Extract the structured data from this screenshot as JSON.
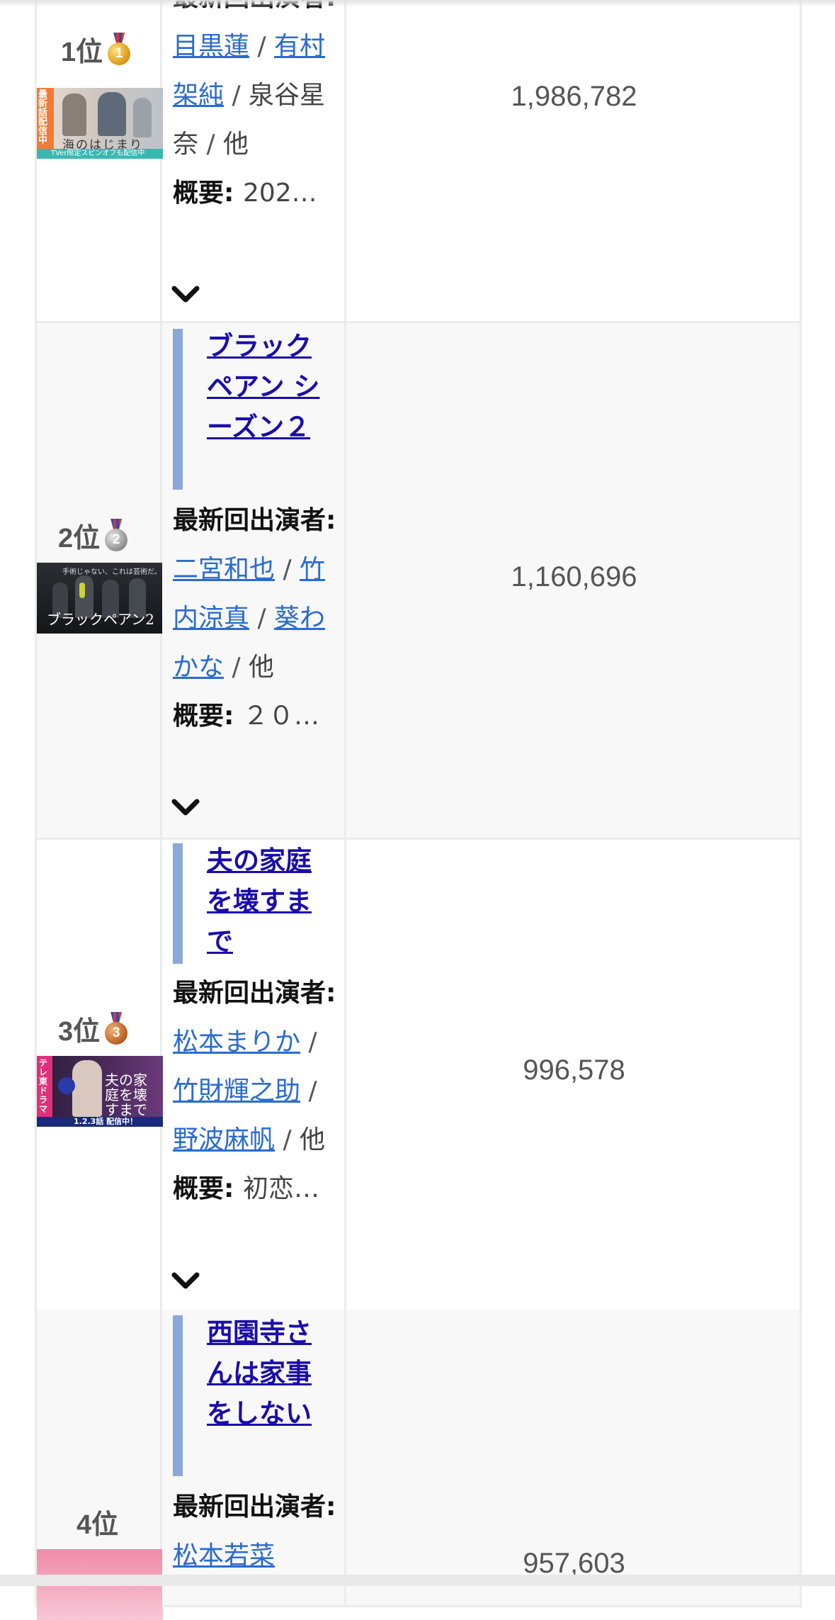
{
  "rows": [
    {
      "rank": "1位",
      "medal_number": "1",
      "medal_color": "#e0a020",
      "title": "",
      "cast_label": "最新回出演者",
      "cast": [
        "目黒蓮",
        "有村架純",
        "泉谷星奈",
        "他"
      ],
      "summary_label": "概要",
      "summary": "202…",
      "views": "1,986,782",
      "thumb_caption": "海のはじまり",
      "thumb_badge": "最新話配信中",
      "thumb_footer": "TVer限定スピンオフも配信中"
    },
    {
      "rank": "2位",
      "medal_number": "2",
      "medal_color": "#9a9a9a",
      "title": "ブラックペアン シーズン２",
      "cast_label": "最新回出演者",
      "cast": [
        "二宮和也",
        "竹内涼真",
        "葵わかな",
        "他"
      ],
      "summary_label": "概要",
      "summary": "２０…",
      "views": "1,160,696",
      "thumb_caption": "ブラックペアン2",
      "thumb_tagline": "手術じゃない、これは芸術だ。"
    },
    {
      "rank": "3位",
      "medal_number": "3",
      "medal_color": "#c0692a",
      "title": "夫の家庭を壊すまで",
      "cast_label": "最新回出演者",
      "cast": [
        "松本まりか",
        "竹財輝之助",
        "野波麻帆",
        "他"
      ],
      "summary_label": "概要",
      "summary": "初恋…",
      "views": "996,578",
      "thumb_caption": "夫の家庭を壊すまで",
      "thumb_badge": "テレ東ドラマ",
      "thumb_footer": "1.2.3話 配信中！"
    },
    {
      "rank": "4位",
      "title": "西園寺さんは家事をしない",
      "cast_label": "最新回出演者",
      "cast": [
        "松本若菜"
      ],
      "views": "957,603"
    }
  ],
  "colors": {
    "link": "#2a6bd1",
    "title_link": "#1a0dab",
    "title_bar": "#8aa8d8",
    "row_alt_bg": "#f8f8f8"
  },
  "icons": {
    "expand": "chevron-down-icon",
    "medal": "medal-icon"
  }
}
